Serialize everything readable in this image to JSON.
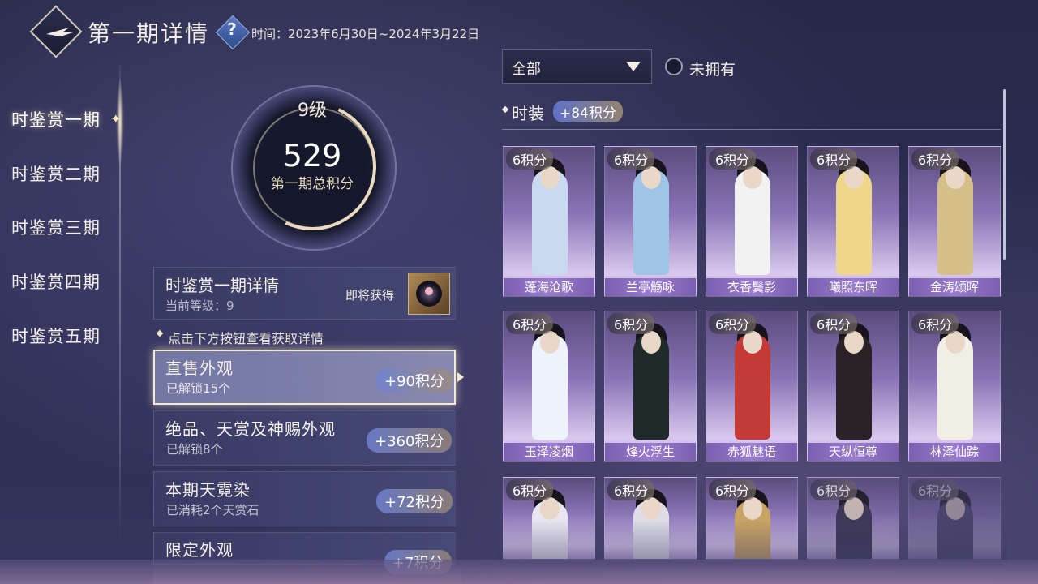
{
  "header": {
    "title": "第一期详情",
    "help_label": "?",
    "time_range": "时间：2023年6月30日~2024年3月22日"
  },
  "sidebar": {
    "items": [
      {
        "label": "时鉴赏一期",
        "active": true
      },
      {
        "label": "时鉴赏二期",
        "active": false
      },
      {
        "label": "时鉴赏三期",
        "active": false
      },
      {
        "label": "时鉴赏四期",
        "active": false
      },
      {
        "label": "时鉴赏五期",
        "active": false
      }
    ]
  },
  "level": {
    "level_label": "9级",
    "total_score": "529",
    "total_label": "第一期总积分",
    "progress_fraction": 0.7
  },
  "detail": {
    "title": "时鉴赏一期详情",
    "current_level": "当前等级：9",
    "upcoming_label": "即将获得"
  },
  "hint": "点击下方按钮查看获取详情",
  "categories": [
    {
      "title": "直售外观",
      "subtitle": "已解锁15个",
      "points": "+90积分",
      "selected": true
    },
    {
      "title": "绝品、天赏及神赐外观",
      "subtitle": "已解锁8个",
      "points": "+360积分",
      "selected": false
    },
    {
      "title": "本期天霓染",
      "subtitle": "已消耗2个天赏石",
      "points": "+72积分",
      "selected": false
    },
    {
      "title": "限定外观",
      "subtitle": "",
      "points": "+7积分",
      "selected": false
    }
  ],
  "filter": {
    "selected": "全部",
    "unowned_label": "未拥有",
    "unowned_checked": false
  },
  "section": {
    "title": "时装",
    "points": "+84积分"
  },
  "outfits": [
    {
      "name": "蓬海沧歌",
      "points": "6积分",
      "color": "#c9d9f0"
    },
    {
      "name": "兰亭觞咏",
      "points": "6积分",
      "color": "#9fc4e6"
    },
    {
      "name": "衣香鬓影",
      "points": "6积分",
      "color": "#f2f2f2"
    },
    {
      "name": "曦照东晖",
      "points": "6积分",
      "color": "#f0d68a"
    },
    {
      "name": "金涛颂晖",
      "points": "6积分",
      "color": "#d6c08a"
    },
    {
      "name": "玉泽凌烟",
      "points": "6积分",
      "color": "#eef2fa"
    },
    {
      "name": "烽火浮生",
      "points": "6积分",
      "color": "#1f2a2a"
    },
    {
      "name": "赤狐魅语",
      "points": "6积分",
      "color": "#c43a36"
    },
    {
      "name": "天纵恒尊",
      "points": "6积分",
      "color": "#2a2226"
    },
    {
      "name": "林泽仙踪",
      "points": "6积分",
      "color": "#f1eee4"
    },
    {
      "name": "",
      "points": "6积分",
      "color": "#e9e6f2"
    },
    {
      "name": "",
      "points": "6积分",
      "color": "#dedde8"
    },
    {
      "name": "",
      "points": "6积分",
      "color": "#c9a465"
    },
    {
      "name": "",
      "points": "6积分",
      "color": "#3a3550"
    },
    {
      "name": "",
      "points": "6积分",
      "color": "#4a4266"
    }
  ]
}
